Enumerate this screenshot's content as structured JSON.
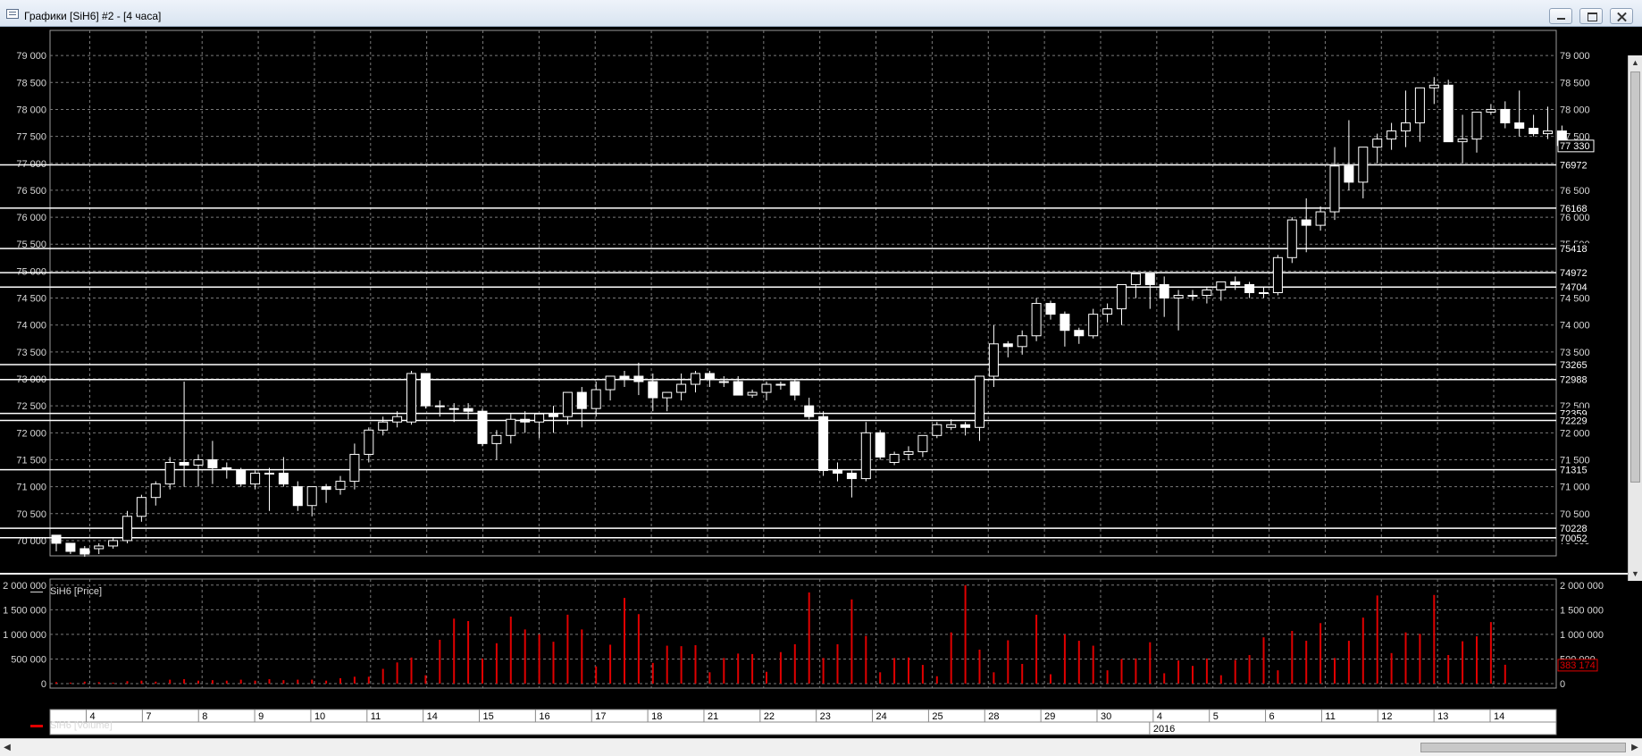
{
  "window": {
    "title": "Графики [SiH6] #2 - [4 часа]"
  },
  "legends": {
    "price": "SiH6 [Price]",
    "volume": "SiH6 [Volume]"
  },
  "colors": {
    "background": "#000000",
    "grid": "#7a7a7a",
    "candle_up": "#000000",
    "candle_down": "#ffffff",
    "candle_outline": "#ffffff",
    "volume": "#e00000",
    "level_line": "#ffffff"
  },
  "chart_data": [
    {
      "type": "candlestick",
      "series_name": "SiH6 [Price]",
      "ylim": [
        69800,
        79400
      ],
      "y_ticks": [
        70000,
        70500,
        71000,
        71500,
        72000,
        72500,
        73000,
        73500,
        74000,
        74500,
        75000,
        75500,
        76000,
        76500,
        77000,
        77500,
        78000,
        78500,
        79000
      ],
      "y_tick_labels_left": [
        "70 000",
        "70 500",
        "71 000",
        "71 500",
        "72 000",
        "72 500",
        "73 000",
        "73 500",
        "74 000",
        "74 500",
        "75 000",
        "75 500",
        "76 000",
        "76 500",
        "77 000",
        "77 500",
        "78 000",
        "78 500",
        "79 000"
      ],
      "y_tick_labels_right": [
        "70 000",
        "70 500",
        "71 000",
        "71 500",
        "72 000",
        "72 500",
        "73 000",
        "73 500",
        "74 000",
        "74 500",
        "75 000",
        "75 500",
        "76 000",
        "76 500",
        "77 000",
        "77 500",
        "78 000",
        "78 500",
        "79 000"
      ],
      "horizontal_levels": [
        {
          "value": 76972,
          "label": "76972"
        },
        {
          "value": 76168,
          "label": "76168"
        },
        {
          "value": 75418,
          "label": "75418"
        },
        {
          "value": 74972,
          "label": "74972"
        },
        {
          "value": 74704,
          "label": "74704"
        },
        {
          "value": 73265,
          "label": "73265"
        },
        {
          "value": 72988,
          "label": "72988"
        },
        {
          "value": 72359,
          "label": "72359"
        },
        {
          "value": 72229,
          "label": "72229"
        },
        {
          "value": 71315,
          "label": "71315"
        },
        {
          "value": 70228,
          "label": "70228"
        },
        {
          "value": 70052,
          "label": "70052"
        }
      ],
      "last_price": {
        "value": 77330,
        "label": "77 330"
      },
      "candles": [
        [
          70100,
          70050,
          69800,
          69950
        ],
        [
          69950,
          69900,
          69750,
          69800
        ],
        [
          69850,
          69900,
          69700,
          69750
        ],
        [
          69850,
          69950,
          69750,
          69900
        ],
        [
          69900,
          70050,
          69850,
          70000
        ],
        [
          70000,
          70550,
          69950,
          70450
        ],
        [
          70450,
          70850,
          70350,
          70800
        ],
        [
          70800,
          71100,
          70650,
          71050
        ],
        [
          71050,
          71550,
          70950,
          71450
        ],
        [
          71450,
          72950,
          71000,
          71400
        ],
        [
          71400,
          71600,
          71000,
          71500
        ],
        [
          71500,
          71850,
          71050,
          71350
        ],
        [
          71350,
          71450,
          71150,
          71350
        ],
        [
          71300,
          71350,
          71000,
          71050
        ],
        [
          71050,
          71300,
          70950,
          71250
        ],
        [
          71250,
          71350,
          70550,
          71250
        ],
        [
          71250,
          71550,
          71000,
          71050
        ],
        [
          71000,
          71100,
          70550,
          70650
        ],
        [
          70650,
          71000,
          70450,
          71000
        ],
        [
          71000,
          71050,
          70700,
          70950
        ],
        [
          70950,
          71200,
          70850,
          71100
        ],
        [
          71100,
          71800,
          70950,
          71600
        ],
        [
          71600,
          72100,
          71450,
          72050
        ],
        [
          72050,
          72300,
          71950,
          72200
        ],
        [
          72200,
          72400,
          72100,
          72300
        ],
        [
          72200,
          73150,
          72150,
          73100
        ],
        [
          73100,
          73100,
          72450,
          72500
        ],
        [
          72500,
          72600,
          72300,
          72500
        ],
        [
          72450,
          72550,
          72200,
          72450
        ],
        [
          72450,
          72550,
          72250,
          72400
        ],
        [
          72400,
          72450,
          71750,
          71800
        ],
        [
          71800,
          72050,
          71500,
          71950
        ],
        [
          71950,
          72350,
          71800,
          72250
        ],
        [
          72250,
          72400,
          72000,
          72200
        ],
        [
          72200,
          72300,
          71900,
          72350
        ],
        [
          72350,
          72500,
          72000,
          72300
        ],
        [
          72300,
          72700,
          72150,
          72750
        ],
        [
          72750,
          72850,
          72100,
          72450
        ],
        [
          72450,
          72950,
          72300,
          72800
        ],
        [
          72800,
          73050,
          72600,
          73050
        ],
        [
          73050,
          73150,
          72850,
          73000
        ],
        [
          73050,
          73300,
          72700,
          72950
        ],
        [
          72950,
          73100,
          72400,
          72650
        ],
        [
          72650,
          72700,
          72400,
          72750
        ],
        [
          72750,
          73100,
          72600,
          72900
        ],
        [
          72900,
          73150,
          72750,
          73100
        ],
        [
          73100,
          73150,
          72850,
          73000
        ],
        [
          72950,
          73050,
          72850,
          72950
        ],
        [
          72950,
          73050,
          72700,
          72700
        ],
        [
          72700,
          72800,
          72650,
          72750
        ],
        [
          72750,
          72950,
          72600,
          72900
        ],
        [
          72900,
          72950,
          72800,
          72900
        ],
        [
          72950,
          73000,
          72600,
          72700
        ],
        [
          72500,
          72650,
          72250,
          72300
        ],
        [
          72300,
          72400,
          71200,
          71300
        ],
        [
          71300,
          71450,
          71100,
          71250
        ],
        [
          71250,
          71300,
          70800,
          71150
        ],
        [
          71150,
          72200,
          71100,
          72000
        ],
        [
          72000,
          72050,
          71500,
          71550
        ],
        [
          71450,
          71650,
          71400,
          71600
        ],
        [
          71600,
          71750,
          71500,
          71650
        ],
        [
          71650,
          71950,
          71550,
          71950
        ],
        [
          71950,
          72200,
          71900,
          72150
        ],
        [
          72100,
          72250,
          72050,
          72150
        ],
        [
          72150,
          72200,
          71950,
          72100
        ],
        [
          72100,
          73000,
          71850,
          73050
        ],
        [
          73050,
          74000,
          72850,
          73650
        ],
        [
          73650,
          73700,
          73400,
          73600
        ],
        [
          73600,
          73900,
          73450,
          73800
        ],
        [
          73800,
          74500,
          73700,
          74400
        ],
        [
          74400,
          74450,
          74100,
          74200
        ],
        [
          74200,
          74250,
          73600,
          73900
        ],
        [
          73900,
          73950,
          73650,
          73800
        ],
        [
          73800,
          74300,
          73750,
          74200
        ],
        [
          74200,
          74400,
          74050,
          74300
        ],
        [
          74300,
          74750,
          74000,
          74750
        ],
        [
          74750,
          74950,
          74500,
          74950
        ],
        [
          74950,
          74950,
          74300,
          74750
        ],
        [
          74750,
          74900,
          74150,
          74500
        ],
        [
          74500,
          74650,
          73900,
          74550
        ],
        [
          74550,
          74650,
          74450,
          74550
        ],
        [
          74550,
          74700,
          74400,
          74650
        ],
        [
          74650,
          74800,
          74450,
          74800
        ],
        [
          74800,
          74900,
          74650,
          74750
        ],
        [
          74750,
          74800,
          74500,
          74600
        ],
        [
          74600,
          74700,
          74500,
          74600
        ],
        [
          74600,
          75300,
          74550,
          75250
        ],
        [
          75250,
          76000,
          75150,
          75950
        ],
        [
          75950,
          76350,
          75350,
          75850
        ],
        [
          75850,
          76200,
          75750,
          76100
        ],
        [
          76100,
          77300,
          75950,
          76950
        ],
        [
          76950,
          77800,
          76500,
          76650
        ],
        [
          76650,
          77300,
          76350,
          77300
        ],
        [
          77300,
          77550,
          77000,
          77450
        ],
        [
          77450,
          77750,
          77250,
          77600
        ],
        [
          77600,
          78350,
          77300,
          77750
        ],
        [
          77750,
          78050,
          77400,
          78400
        ],
        [
          78400,
          78600,
          78100,
          78450
        ],
        [
          78450,
          78550,
          77400,
          77400
        ],
        [
          77400,
          77900,
          77000,
          77450
        ],
        [
          77450,
          77900,
          77200,
          77950
        ],
        [
          77950,
          78100,
          77900,
          78000
        ],
        [
          78000,
          78150,
          77650,
          77750
        ],
        [
          77750,
          78350,
          77500,
          77650
        ],
        [
          77650,
          77900,
          77500,
          77550
        ],
        [
          77550,
          78050,
          77450,
          77600
        ],
        [
          77600,
          77700,
          77300,
          77330
        ]
      ]
    },
    {
      "type": "bar",
      "series_name": "SiH6 [Volume]",
      "ylim": [
        0,
        2050000
      ],
      "y_ticks": [
        0,
        500000,
        1000000,
        1500000,
        2000000
      ],
      "y_tick_labels_left": [
        "0",
        "500 000",
        "1 000 000",
        "1 500 000",
        "2 000 000"
      ],
      "y_tick_labels_right": [
        "0",
        "500 000",
        "1 000 000",
        "1 500 000",
        "2 000 000"
      ],
      "last_value": {
        "value": 383174,
        "label": "383 174"
      },
      "values": [
        30000,
        20000,
        40000,
        30000,
        20000,
        50000,
        60000,
        40000,
        80000,
        90000,
        60000,
        70000,
        60000,
        80000,
        60000,
        90000,
        70000,
        80000,
        80000,
        60000,
        110000,
        140000,
        140000,
        300000,
        430000,
        530000,
        170000,
        890000,
        1320000,
        1270000,
        510000,
        820000,
        1360000,
        1100000,
        1000000,
        850000,
        1400000,
        1100000,
        350000,
        790000,
        1740000,
        1410000,
        420000,
        770000,
        760000,
        780000,
        230000,
        520000,
        610000,
        600000,
        240000,
        640000,
        800000,
        1850000,
        520000,
        800000,
        1710000,
        970000,
        230000,
        520000,
        530000,
        380000,
        150000,
        1040000,
        2000000,
        690000,
        230000,
        880000,
        400000,
        1400000,
        190000,
        1000000,
        870000,
        770000,
        270000,
        500000,
        510000,
        840000,
        210000,
        470000,
        360000,
        510000,
        170000,
        480000,
        580000,
        940000,
        270000,
        1070000,
        870000,
        1230000,
        520000,
        870000,
        1340000,
        1790000,
        620000,
        1040000,
        1010000,
        1800000,
        580000,
        860000,
        960000,
        1250000,
        383174
      ]
    }
  ],
  "time_axis": {
    "day_labels": [
      "4",
      "7",
      "8",
      "9",
      "10",
      "11",
      "14",
      "15",
      "16",
      "17",
      "18",
      "21",
      "22",
      "23",
      "24",
      "25",
      "28",
      "29",
      "30",
      "4",
      "5",
      "6",
      "11",
      "12",
      "13",
      "14"
    ],
    "year_label": "2016"
  },
  "scrollbars": {
    "up_arrow": "▲",
    "down_arrow": "▼",
    "left_arrow": "◀",
    "right_arrow": "▶"
  }
}
